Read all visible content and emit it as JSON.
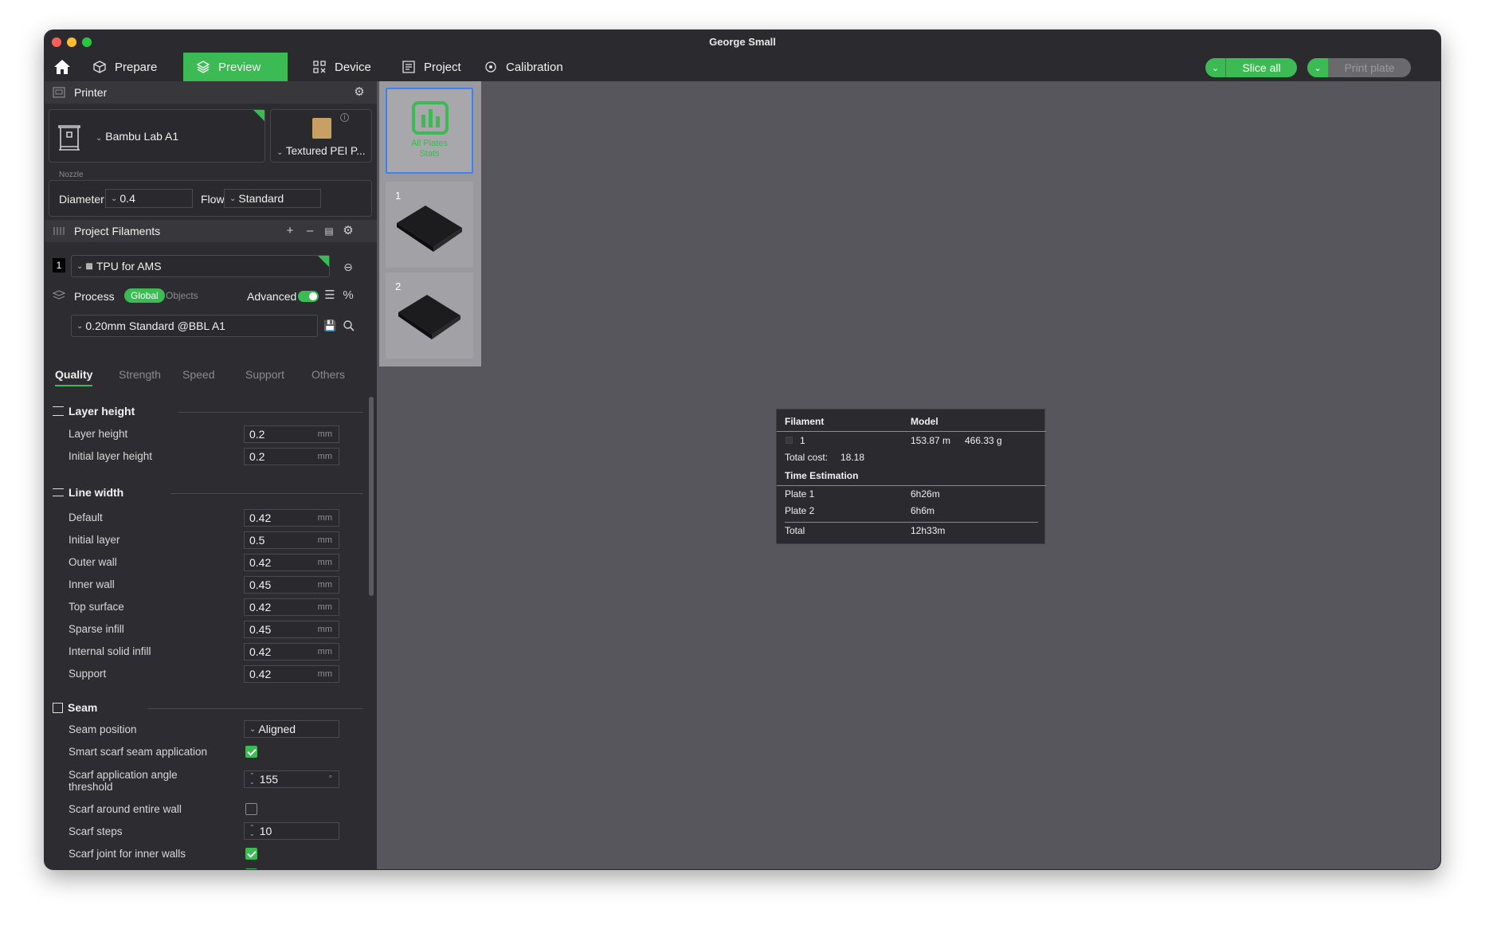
{
  "window": {
    "title": "George Small"
  },
  "nav": {
    "tabs": [
      {
        "label": "Prepare",
        "icon": "cube-icon"
      },
      {
        "label": "Preview",
        "icon": "layers-icon",
        "active": true
      },
      {
        "label": "Device",
        "icon": "device-icon"
      },
      {
        "label": "Project",
        "icon": "project-icon"
      },
      {
        "label": "Calibration",
        "icon": "calibration-icon"
      }
    ],
    "slice_label": "Slice all",
    "print_label": "Print plate"
  },
  "printer": {
    "section_title": "Printer",
    "printer_name": "Bambu Lab A1",
    "plate_type": "Textured PEI P...",
    "nozzle_label": "Nozzle",
    "diameter_label": "Diameter",
    "diameter_value": "0.4",
    "flow_label": "Flow",
    "flow_value": "Standard"
  },
  "filaments": {
    "section_title": "Project Filaments",
    "items": [
      {
        "index": "1",
        "name": "TPU for AMS"
      }
    ]
  },
  "process": {
    "section_title": "Process",
    "global_label": "Global",
    "objects_label": "Objects",
    "advanced_label": "Advanced",
    "advanced_on": true,
    "preset": "0.20mm Standard @BBL A1",
    "tabs": [
      "Quality",
      "Strength",
      "Speed",
      "Support",
      "Others"
    ],
    "active_tab": "Quality"
  },
  "layer_height": {
    "title": "Layer height",
    "rows": [
      {
        "label": "Layer height",
        "value": "0.2",
        "unit": "mm"
      },
      {
        "label": "Initial layer height",
        "value": "0.2",
        "unit": "mm"
      }
    ]
  },
  "line_width": {
    "title": "Line width",
    "rows": [
      {
        "label": "Default",
        "value": "0.42",
        "unit": "mm"
      },
      {
        "label": "Initial layer",
        "value": "0.5",
        "unit": "mm"
      },
      {
        "label": "Outer wall",
        "value": "0.42",
        "unit": "mm"
      },
      {
        "label": "Inner wall",
        "value": "0.45",
        "unit": "mm"
      },
      {
        "label": "Top surface",
        "value": "0.42",
        "unit": "mm"
      },
      {
        "label": "Sparse infill",
        "value": "0.45",
        "unit": "mm"
      },
      {
        "label": "Internal solid infill",
        "value": "0.42",
        "unit": "mm"
      },
      {
        "label": "Support",
        "value": "0.42",
        "unit": "mm"
      }
    ]
  },
  "seam": {
    "title": "Seam",
    "seam_position_label": "Seam position",
    "seam_position_value": "Aligned",
    "smart_scarf_label": "Smart scarf seam application",
    "smart_scarf_checked": true,
    "scarf_angle_label_1": "Scarf application angle",
    "scarf_angle_label_2": "threshold",
    "scarf_angle_value": "155",
    "scarf_angle_unit": "°",
    "scarf_entire_label": "Scarf around entire wall",
    "scarf_entire_checked": false,
    "scarf_steps_label": "Scarf steps",
    "scarf_steps_value": "10",
    "scarf_inner_label": "Scarf joint for inner walls",
    "scarf_inner_checked": true
  },
  "plates": {
    "stats_label_1": "All Plates",
    "stats_label_2": "Stats",
    "items": [
      {
        "number": "1"
      },
      {
        "number": "2"
      }
    ]
  },
  "stats_popup": {
    "filament_header": "Filament",
    "model_header": "Model",
    "filament_index": "1",
    "model_length": "153.87 m",
    "model_weight": "466.33 g",
    "total_cost_label": "Total cost:",
    "total_cost_value": "18.18",
    "time_header": "Time Estimation",
    "plates": [
      {
        "label": "Plate 1",
        "time": "6h26m"
      },
      {
        "label": "Plate 2",
        "time": "6h6m"
      }
    ],
    "total_label": "Total",
    "total_time": "12h33m"
  },
  "colors": {
    "accent": "#3cba54",
    "panel_bg": "#2d2d31",
    "canvas_bg": "#56565c",
    "selection_border": "#3b82f6"
  }
}
